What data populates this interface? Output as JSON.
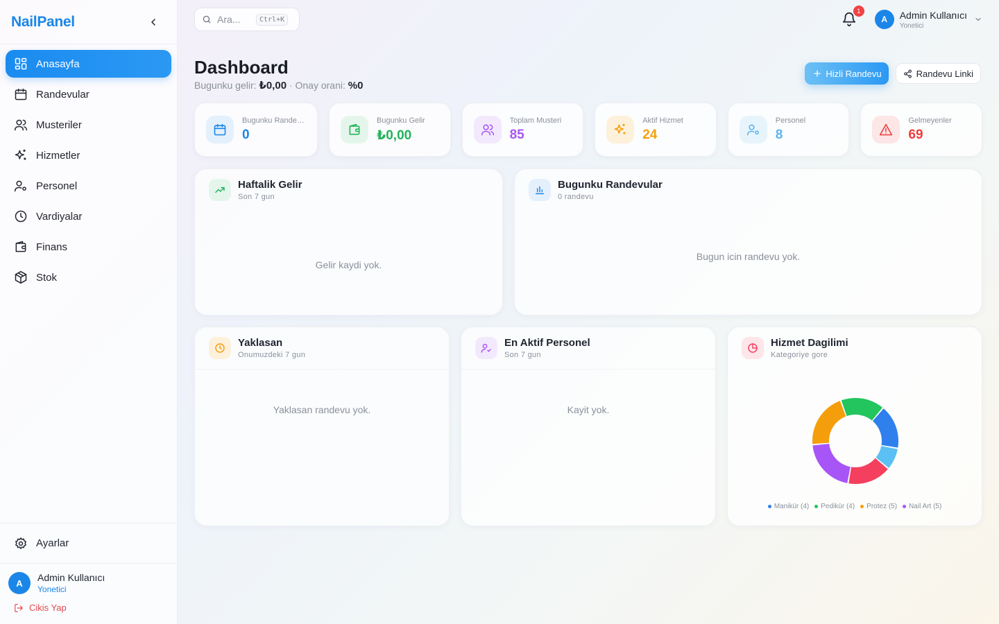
{
  "brand": "NailPanel",
  "sidebar": {
    "items": [
      {
        "label": "Anasayfa",
        "icon": "dashboard-icon"
      },
      {
        "label": "Randevular",
        "icon": "calendar-icon"
      },
      {
        "label": "Musteriler",
        "icon": "users-icon"
      },
      {
        "label": "Hizmetler",
        "icon": "sparkles-icon"
      },
      {
        "label": "Personel",
        "icon": "user-cog-icon"
      },
      {
        "label": "Vardiyalar",
        "icon": "clock-icon"
      },
      {
        "label": "Finans",
        "icon": "wallet-icon"
      },
      {
        "label": "Stok",
        "icon": "package-icon"
      }
    ],
    "settings_label": "Ayarlar",
    "user_name": "Admin Kullanıcı",
    "user_role": "Yonetici",
    "avatar_initial": "A",
    "logout_label": "Cikis Yap"
  },
  "topbar": {
    "search_placeholder": "Ara...",
    "search_shortcut": "Ctrl+K",
    "notification_count": "1",
    "user_name": "Admin Kullanıcı",
    "user_role": "Yonetici",
    "avatar_initial": "A"
  },
  "header": {
    "title": "Dashboard",
    "revenue_label": "Bugunku gelir:",
    "revenue_value": "₺0,00",
    "separator": " · ",
    "approval_label": "Onay orani:",
    "approval_value": "%0",
    "quick_appointment": "Hizli Randevu",
    "appointment_link": "Randevu Linki"
  },
  "stats": [
    {
      "label": "Bugunku Randevular",
      "value": "0",
      "color": "#1a86e8",
      "bg": "#e5f0fd"
    },
    {
      "label": "Bugunku Gelir",
      "value": "₺0,00",
      "color": "#22b35a",
      "bg": "#e4f6eb"
    },
    {
      "label": "Toplam Musteri",
      "value": "85",
      "color": "#a855f7",
      "bg": "#f3e9fd"
    },
    {
      "label": "Aktif Hizmet",
      "value": "24",
      "color": "#f59e0b",
      "bg": "#fdf1dc"
    },
    {
      "label": "Personel",
      "value": "8",
      "color": "#5bb5ee",
      "bg": "#e8f4fc"
    },
    {
      "label": "Gelmeyenler",
      "value": "69",
      "color": "#ef3b3b",
      "bg": "#fde6e6"
    }
  ],
  "panels": {
    "weekly": {
      "title": "Haftalik Gelir",
      "subtitle": "Son 7 gun",
      "empty": "Gelir kaydi yok."
    },
    "today": {
      "title": "Bugunku Randevular",
      "subtitle": "0 randevu",
      "empty": "Bugun icin randevu yok."
    },
    "upcoming": {
      "title": "Yaklasan",
      "subtitle": "Onumuzdeki 7 gun",
      "empty": "Yaklasan randevu yok."
    },
    "staff": {
      "title": "En Aktif Personel",
      "subtitle": "Son 7 gun",
      "empty": "Kayit yok."
    },
    "distribution": {
      "title": "Hizmet Dagilimi",
      "subtitle": "Kategoriye gore"
    }
  },
  "chart_data": {
    "type": "pie",
    "categories": [
      "Manikür",
      "Pedikür",
      "Protez",
      "Nail Art"
    ],
    "legend_labels": [
      "Manikür (4)",
      "Pedikür (4)",
      "Protez (5)",
      "Nail Art (5)"
    ],
    "slices": [
      {
        "color": "#22c55e",
        "value": 4
      },
      {
        "color": "#2f80ed",
        "value": 4
      },
      {
        "color": "#5bc0f3",
        "value": 2
      },
      {
        "color": "#f43f5e",
        "value": 4
      },
      {
        "color": "#a855f7",
        "value": 5
      },
      {
        "color": "#f59e0b",
        "value": 5
      }
    ],
    "legend_colors": [
      "#2f80ed",
      "#22c55e",
      "#f59e0b",
      "#a855f7"
    ]
  }
}
